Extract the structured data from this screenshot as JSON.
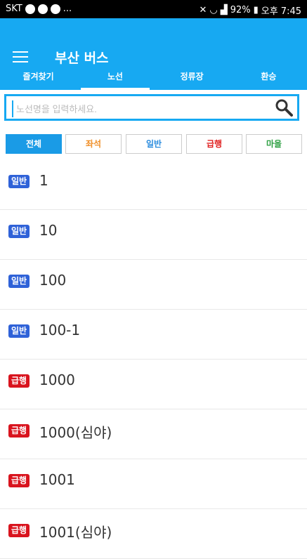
{
  "status_bar": {
    "carrier": "SKT",
    "ellipsis": "...",
    "battery": "92%",
    "time": "오후 7:45"
  },
  "header": {
    "title": "부산 버스",
    "menu_icon": "hamburger-menu-icon"
  },
  "tabs": [
    {
      "label": "즐겨찾기",
      "active": false
    },
    {
      "label": "노선",
      "active": true
    },
    {
      "label": "정류장",
      "active": false
    },
    {
      "label": "환승",
      "active": false
    }
  ],
  "search": {
    "placeholder": "노선명을 입력하세요.",
    "value": "",
    "icon": "search-icon"
  },
  "filters": [
    {
      "label": "전체",
      "active": true,
      "color": "#ffffff"
    },
    {
      "label": "좌석",
      "active": false,
      "color": "#f0902a"
    },
    {
      "label": "일반",
      "active": false,
      "color": "#2a8cde"
    },
    {
      "label": "급행",
      "active": false,
      "color": "#e02020"
    },
    {
      "label": "마을",
      "active": false,
      "color": "#2ea043"
    }
  ],
  "badge_colors": {
    "일반": "#2f62d8",
    "급행": "#d9141e"
  },
  "routes": [
    {
      "type": "일반",
      "number": "1"
    },
    {
      "type": "일반",
      "number": "10"
    },
    {
      "type": "일반",
      "number": "100"
    },
    {
      "type": "일반",
      "number": "100-1"
    },
    {
      "type": "급행",
      "number": "1000"
    },
    {
      "type": "급행",
      "number": "1000(심야)"
    },
    {
      "type": "급행",
      "number": "1001"
    },
    {
      "type": "급행",
      "number": "1001(심야)"
    }
  ]
}
